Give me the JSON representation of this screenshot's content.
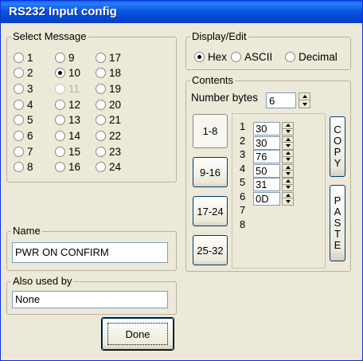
{
  "window": {
    "title": "RS232 Input config"
  },
  "select_message": {
    "legend": "Select Message",
    "options": [
      {
        "label": "1",
        "checked": false,
        "enabled": true
      },
      {
        "label": "2",
        "checked": false,
        "enabled": true
      },
      {
        "label": "3",
        "checked": false,
        "enabled": true
      },
      {
        "label": "4",
        "checked": false,
        "enabled": true
      },
      {
        "label": "5",
        "checked": false,
        "enabled": true
      },
      {
        "label": "6",
        "checked": false,
        "enabled": true
      },
      {
        "label": "7",
        "checked": false,
        "enabled": true
      },
      {
        "label": "8",
        "checked": false,
        "enabled": true
      },
      {
        "label": "9",
        "checked": false,
        "enabled": true
      },
      {
        "label": "10",
        "checked": true,
        "enabled": true
      },
      {
        "label": "11",
        "checked": false,
        "enabled": false
      },
      {
        "label": "12",
        "checked": false,
        "enabled": true
      },
      {
        "label": "13",
        "checked": false,
        "enabled": true
      },
      {
        "label": "14",
        "checked": false,
        "enabled": true
      },
      {
        "label": "15",
        "checked": false,
        "enabled": true
      },
      {
        "label": "16",
        "checked": false,
        "enabled": true
      },
      {
        "label": "17",
        "checked": false,
        "enabled": true
      },
      {
        "label": "18",
        "checked": false,
        "enabled": true
      },
      {
        "label": "19",
        "checked": false,
        "enabled": true
      },
      {
        "label": "20",
        "checked": false,
        "enabled": true
      },
      {
        "label": "21",
        "checked": false,
        "enabled": true
      },
      {
        "label": "22",
        "checked": false,
        "enabled": true
      },
      {
        "label": "23",
        "checked": false,
        "enabled": true
      },
      {
        "label": "24",
        "checked": false,
        "enabled": true
      }
    ]
  },
  "display_edit": {
    "legend": "Display/Edit",
    "options": [
      {
        "label": "Hex",
        "checked": true
      },
      {
        "label": "ASCII",
        "checked": false
      },
      {
        "label": "Decimal",
        "checked": false
      }
    ]
  },
  "contents": {
    "legend": "Contents",
    "number_bytes_label": "Number bytes",
    "number_bytes_value": "6",
    "range_buttons": [
      {
        "label": "1-8",
        "pressed": true
      },
      {
        "label": "9-16",
        "pressed": false
      },
      {
        "label": "17-24",
        "pressed": false
      },
      {
        "label": "25-32",
        "pressed": false
      }
    ],
    "row_numbers": [
      "1",
      "2",
      "3",
      "4",
      "5",
      "6",
      "7",
      "8"
    ],
    "byte_values": [
      "30",
      "30",
      "76",
      "50",
      "31",
      "0D"
    ],
    "copy_label": "COPY",
    "paste_label": "PASTE"
  },
  "name": {
    "legend": "Name",
    "value": "PWR ON CONFIRM"
  },
  "also_used_by": {
    "legend": "Also used by",
    "value": "None"
  },
  "done_label": "Done",
  "colors": {
    "titlebar": "#0054e3",
    "dialog_bg": "#ece9d8"
  }
}
